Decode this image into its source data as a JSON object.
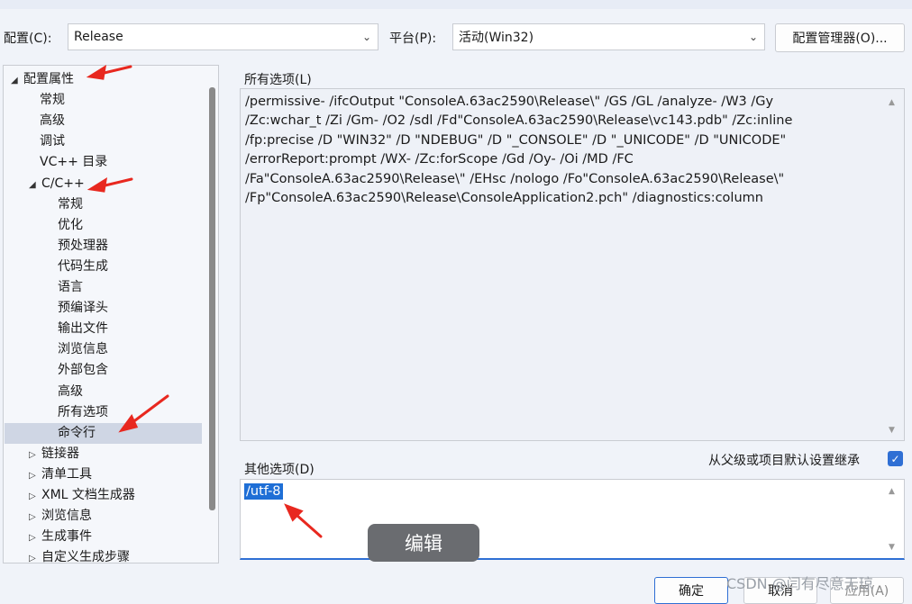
{
  "toolbar": {
    "config_label": "配置(C):",
    "config_value": "Release",
    "platform_label": "平台(P):",
    "platform_value": "活动(Win32)",
    "manager_button": "配置管理器(O)..."
  },
  "tree": {
    "items": [
      {
        "label": "配置属性",
        "toggle": "◢"
      },
      {
        "label": "常规"
      },
      {
        "label": "高级"
      },
      {
        "label": "调试"
      },
      {
        "label": "VC++ 目录"
      },
      {
        "label": "C/C++",
        "toggle": "◢"
      },
      {
        "label": "常规"
      },
      {
        "label": "优化"
      },
      {
        "label": "预处理器"
      },
      {
        "label": "代码生成"
      },
      {
        "label": "语言"
      },
      {
        "label": "预编译头"
      },
      {
        "label": "输出文件"
      },
      {
        "label": "浏览信息"
      },
      {
        "label": "外部包含"
      },
      {
        "label": "高级"
      },
      {
        "label": "所有选项"
      },
      {
        "label": "命令行"
      },
      {
        "label": "链接器",
        "toggle": "▷"
      },
      {
        "label": "清单工具",
        "toggle": "▷"
      },
      {
        "label": "XML 文档生成器",
        "toggle": "▷"
      },
      {
        "label": "浏览信息",
        "toggle": "▷"
      },
      {
        "label": "生成事件",
        "toggle": "▷"
      },
      {
        "label": "自定义生成步骤",
        "toggle": "▷"
      }
    ]
  },
  "all_options": {
    "label": "所有选项(L)",
    "text": "/permissive- /ifcOutput \"ConsoleA.63ac2590\\Release\\\" /GS /GL /analyze- /W3 /Gy\n/Zc:wchar_t /Zi /Gm- /O2 /sdl /Fd\"ConsoleA.63ac2590\\Release\\vc143.pdb\" /Zc:inline\n/fp:precise /D \"WIN32\" /D \"NDEBUG\" /D \"_CONSOLE\" /D \"_UNICODE\" /D \"UNICODE\"\n/errorReport:prompt /WX- /Zc:forScope /Gd /Oy- /Oi /MD /FC\n/Fa\"ConsoleA.63ac2590\\Release\\\" /EHsc /nologo /Fo\"ConsoleA.63ac2590\\Release\\\"\n/Fp\"ConsoleA.63ac2590\\Release\\ConsoleApplication2.pch\" /diagnostics:column"
  },
  "other_options": {
    "label": "其他选项(D)",
    "value": "/utf-8",
    "inherit_label": "从父级或项目默认设置继承",
    "inherit_checked": true
  },
  "edit_tip": "编辑",
  "buttons": {
    "ok": "确定",
    "cancel": "取消",
    "apply": "应用(A)"
  },
  "watermark": "CSDN @闫有尽意无琼",
  "colors": {
    "accent": "#2f6fd4",
    "annotation_arrow": "#e8281f",
    "selection": "#cfd6e4"
  }
}
